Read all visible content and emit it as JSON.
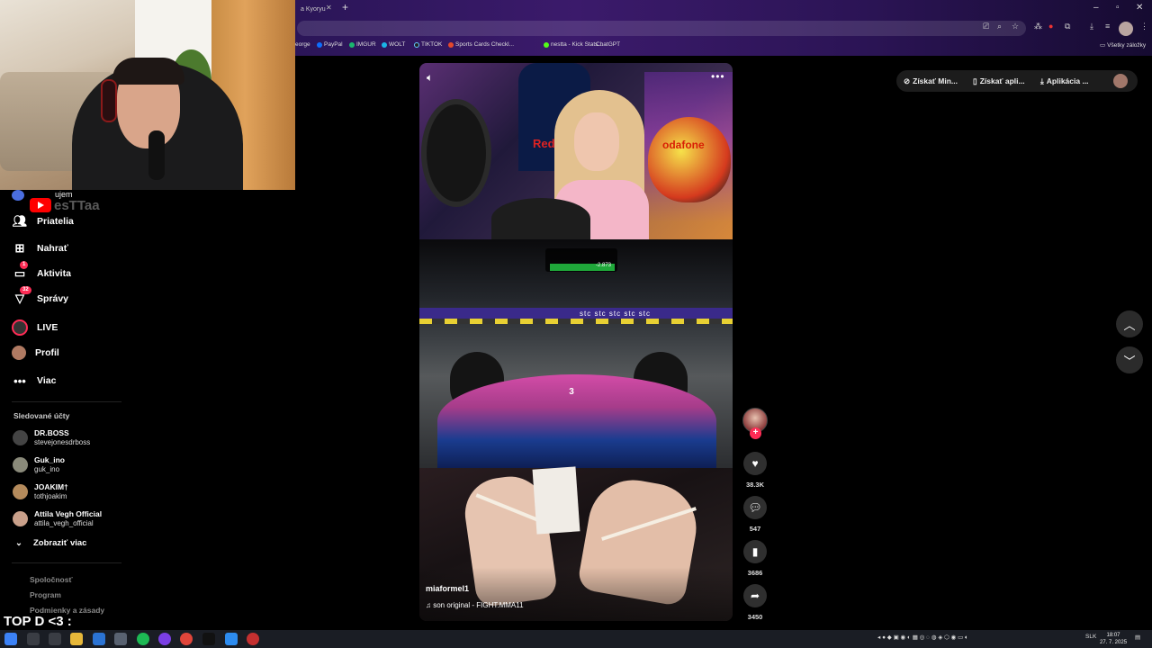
{
  "browser": {
    "tab_title": "a Kyoryu",
    "bookmarks": [
      "eorge",
      "PayPal",
      "IMGUR",
      "WOLT",
      "TIKTOK",
      "Sports Cards Checkl...",
      "nestta - Kick Stats...",
      "ChatGPT"
    ],
    "all_bookmarks": "Všetky záložky"
  },
  "webcam": {
    "yt_overlay": "esTTaa"
  },
  "sidebar": {
    "cut_item": "ujem",
    "nav": [
      {
        "label": "Priatelia",
        "icon": "friends-icon"
      },
      {
        "label": "Nahrať",
        "icon": "upload-icon"
      },
      {
        "label": "Aktivita",
        "icon": "activity-icon",
        "badge": "1"
      },
      {
        "label": "Správy",
        "icon": "messages-icon",
        "badge": "32"
      },
      {
        "label": "LIVE",
        "icon": "live-icon"
      },
      {
        "label": "Profil",
        "icon": "profile-avatar"
      },
      {
        "label": "Viac",
        "icon": "more-icon"
      }
    ],
    "following_title": "Sledované účty",
    "following": [
      {
        "name": "DR.BOSS",
        "handle": "stevejonesdrboss"
      },
      {
        "name": "Guk_ino",
        "handle": "guk_ino"
      },
      {
        "name": "JOAKIM†",
        "handle": "tothjoakim"
      },
      {
        "name": "Attila Vegh Official",
        "handle": "attila_vegh_official"
      }
    ],
    "show_more": "Zobraziť viac",
    "footer": [
      "Spoločnosť",
      "Program",
      "Podmienky a zásady"
    ]
  },
  "overlay_text": "TOP D <3 :",
  "video": {
    "author": "miaformel1",
    "sound": "son original - FIGHT.MMA11",
    "hud_delta": "-2.873",
    "hud_gear": "3",
    "hud_stc": "stc  stc  stc  stc  stc"
  },
  "actions": {
    "likes": "38.3K",
    "comments": "547",
    "saves": "3686",
    "shares": "3450"
  },
  "top_actions": [
    "Získať Min...",
    "Získať apli...",
    "Aplikácia ..."
  ],
  "taskbar": {
    "lang": "SLK",
    "time": "18:07",
    "date": "27. 7. 2025"
  },
  "colors": {
    "accent": "#fe2c55",
    "background": "#000000"
  }
}
